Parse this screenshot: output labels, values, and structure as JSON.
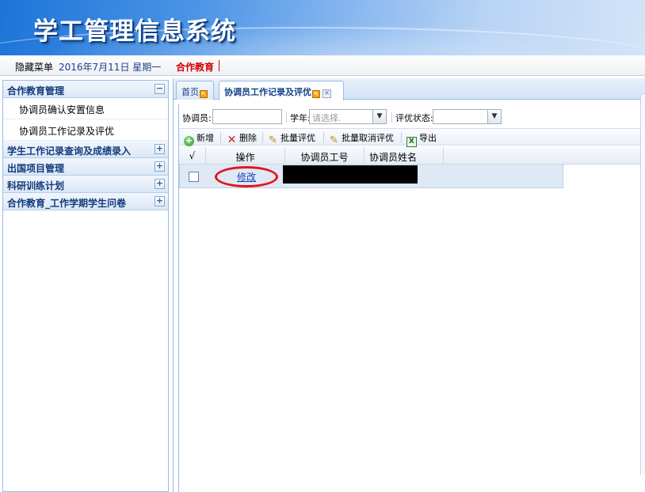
{
  "banner": {
    "title": "学工管理信息系统"
  },
  "infobar": {
    "hide_menu": "隐藏菜单",
    "date": "2016年7月11日 星期一",
    "module": "合作教育"
  },
  "sidebar": {
    "groups": [
      {
        "title": "合作教育管理",
        "toggle": "−",
        "items": [
          "协调员确认安置信息",
          "协调员工作记录及评优"
        ]
      },
      {
        "title": "学生工作记录查询及成绩录入",
        "toggle": "+"
      },
      {
        "title": "出国项目管理",
        "toggle": "+"
      },
      {
        "title": "科研训练计划",
        "toggle": "+"
      },
      {
        "title": "合作教育_工作学期学生问卷",
        "toggle": "+"
      }
    ]
  },
  "tabs": {
    "home": "首页",
    "active": "协调员工作记录及评优",
    "close": "×"
  },
  "filters": {
    "coordinator_label": "协调员:",
    "year_label": "学年:",
    "year_placeholder": "请选择.",
    "status_label": "评优状态:"
  },
  "toolbar": {
    "add": "新增",
    "delete": "删除",
    "batch_rate": "批量评优",
    "batch_cancel": "批量取消评优",
    "export": "导出"
  },
  "grid": {
    "columns": [
      "√",
      "操作",
      "协调员工号",
      "协调员姓名"
    ],
    "rows": [
      {
        "action": "修改"
      }
    ]
  },
  "colors": {
    "accent": "#15428b",
    "highlight_red": "#e3141d",
    "module_red": "#d10000"
  }
}
